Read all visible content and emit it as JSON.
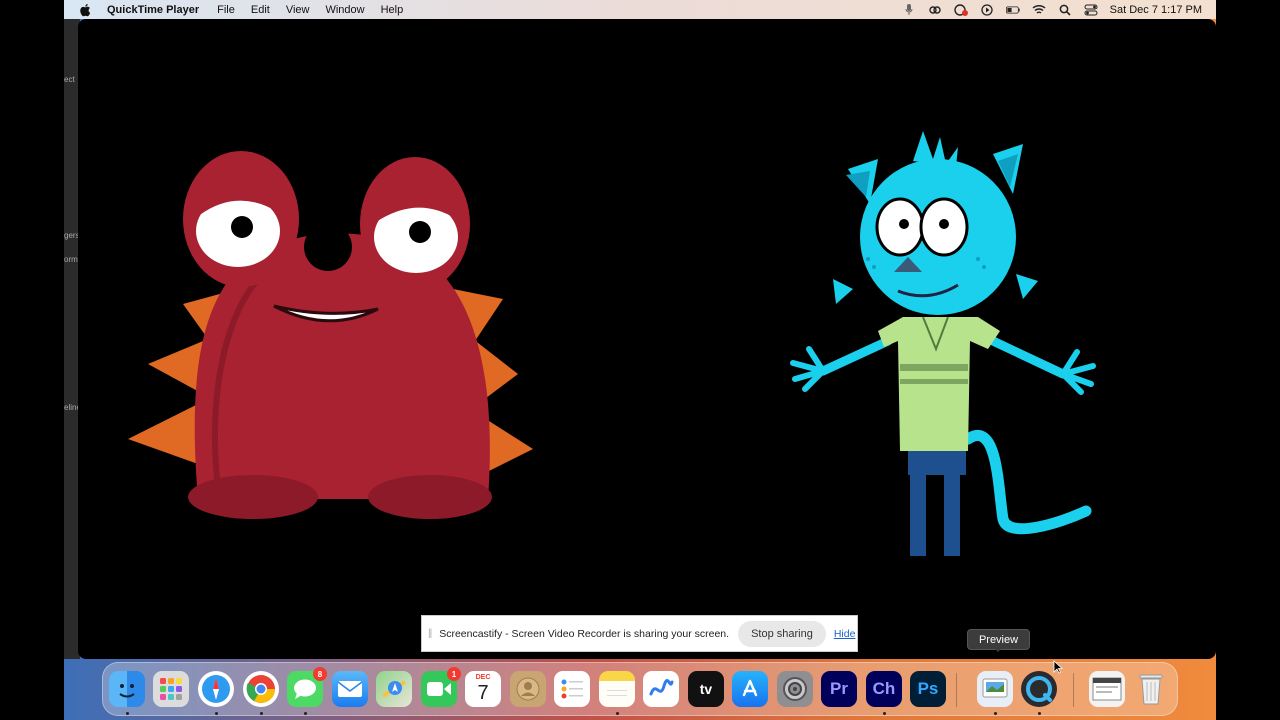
{
  "menubar": {
    "app_name": "QuickTime Player",
    "menus": [
      "File",
      "Edit",
      "View",
      "Window",
      "Help"
    ],
    "clock": "Sat Dec 7  1:17 PM"
  },
  "background_app": {
    "fragments": [
      "ect",
      "gers",
      "orm",
      "eline"
    ]
  },
  "screen_share": {
    "message": "Screencastify - Screen Video Recorder is sharing your screen.",
    "stop_label": "Stop sharing",
    "hide_label": "Hide"
  },
  "tooltip": {
    "label": "Preview"
  },
  "dock": {
    "items": [
      {
        "name": "Finder",
        "icon": "finder-icon",
        "running": true
      },
      {
        "name": "Launchpad",
        "icon": "launchpad-icon",
        "running": false
      },
      {
        "name": "Safari",
        "icon": "safari-icon",
        "running": true
      },
      {
        "name": "Chrome",
        "icon": "chrome-icon",
        "running": true
      },
      {
        "name": "Messages",
        "icon": "messages-icon",
        "running": true,
        "badge": "8"
      },
      {
        "name": "Mail",
        "icon": "mail-icon",
        "running": false
      },
      {
        "name": "Maps",
        "icon": "maps-icon",
        "running": false
      },
      {
        "name": "FaceTime",
        "icon": "facetime-icon",
        "running": false,
        "badge": "1"
      },
      {
        "name": "Calendar",
        "icon": "calendar-icon",
        "running": false,
        "month": "DEC",
        "day": "7"
      },
      {
        "name": "Contacts",
        "icon": "contacts-icon",
        "running": false
      },
      {
        "name": "Reminders",
        "icon": "reminders-icon",
        "running": false
      },
      {
        "name": "Notes",
        "icon": "notes-icon",
        "running": true
      },
      {
        "name": "Freeform",
        "icon": "freeform-icon",
        "running": false
      },
      {
        "name": "Apple TV",
        "icon": "appletv-icon",
        "running": false,
        "label": "tv"
      },
      {
        "name": "App Store",
        "icon": "appstore-icon",
        "running": false
      },
      {
        "name": "System Settings",
        "icon": "settings-icon",
        "running": false
      },
      {
        "name": "Premiere Pro",
        "icon": "premiere-icon",
        "running": false,
        "label": "Pr"
      },
      {
        "name": "Character Animator",
        "icon": "character-animator-icon",
        "running": true,
        "label": "Ch"
      },
      {
        "name": "Photoshop",
        "icon": "photoshop-icon",
        "running": false,
        "label": "Ps"
      },
      {
        "name": "Preview",
        "icon": "preview-icon",
        "running": true
      },
      {
        "name": "QuickTime Player",
        "icon": "quicktime-icon",
        "running": true
      },
      {
        "name": "Downloads",
        "icon": "downloads-stack-icon",
        "running": false
      },
      {
        "name": "Trash",
        "icon": "trash-icon",
        "running": false
      }
    ]
  },
  "colors": {
    "monster_red": "#a82232",
    "monster_spikes": "#e06a24",
    "cat_cyan": "#1ad0ec",
    "cat_shirt": "#b6e38c",
    "cat_pants": "#1e4f8e"
  }
}
